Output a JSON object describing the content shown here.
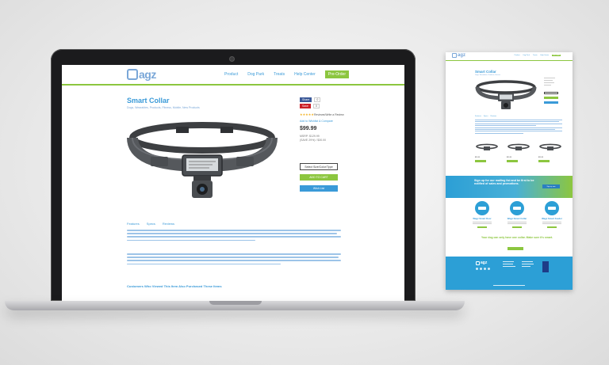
{
  "site": {
    "logo_text": "agz",
    "nav": [
      {
        "label": "Product"
      },
      {
        "label": "Dog Park"
      },
      {
        "label": "Treats"
      },
      {
        "label": "Help Center"
      }
    ],
    "nav_cta": "Pre-Order"
  },
  "product": {
    "title": "Smart Collar",
    "categories": "Dogs, Wearables, Products, Fitness, Mobile, New Products",
    "share_label": "Share",
    "share_count": "0",
    "save_label": "Save",
    "save_count": "0",
    "stars": "★★★★★",
    "reviews": "Reviews/Write a Review",
    "availability": "Add to Wishlist & Compare",
    "price": "$99.99",
    "msrp": "MSRP: $129.99",
    "you_save": "(SAVE 29%) / $30.00",
    "select_button": "Select Size/Color/Type",
    "cart_button": "ADD TO CART",
    "wish_button": "Wish List"
  },
  "tabs": [
    {
      "label": "Features"
    },
    {
      "label": "Specs"
    },
    {
      "label": "Reviews"
    }
  ],
  "related_title": "Customers Who Viewed This Item Also Purchased These Items",
  "page_mock": {
    "logo_text": "agz",
    "nav": [
      "Product",
      "Dog Park",
      "Treats",
      "Help Center"
    ],
    "nav_cta": "Pre-Order",
    "title": "Smart Collar",
    "subtitle": "Dogs, Wearables, Products, Fitness",
    "tabs": [
      "Features",
      "Specs",
      "Reviews"
    ],
    "related_prices": [
      "$99.99",
      "$99.99",
      "$99.99"
    ],
    "newsletter_text": "Sign up for our mailing list and be first to be notified of sales and promotions.",
    "newsletter_button": "Sign up now",
    "products": [
      {
        "name": "Wagz Smart Door"
      },
      {
        "name": "Wagz Smart Collar"
      },
      {
        "name": "Wagz Smart Feeder"
      }
    ],
    "tagline": "Your dog can only have one collar. Make sure it's smart.",
    "footer_logo": "agz"
  },
  "colors": {
    "brand_blue": "#3a9ad8",
    "brand_green": "#8cc63f",
    "logo_blue": "#7aa7d8"
  }
}
